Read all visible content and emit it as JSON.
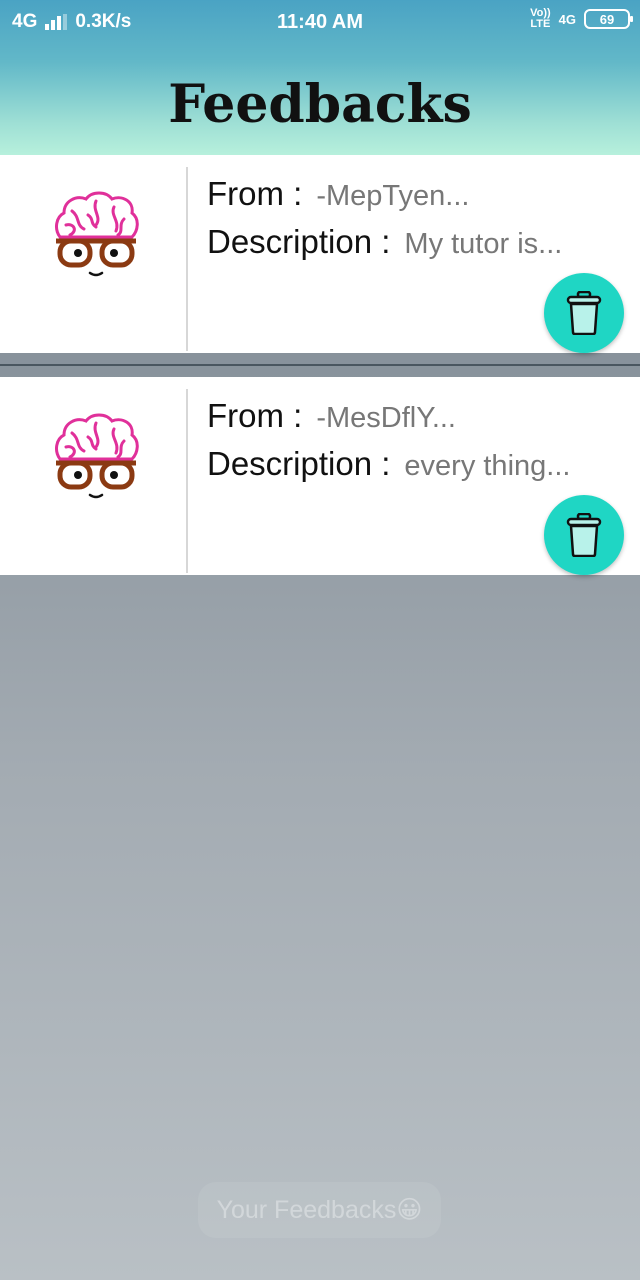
{
  "status_bar": {
    "network": "4G",
    "speed": "0.3K/s",
    "time": "11:40 AM",
    "volte_top": "Vo))",
    "volte_bottom": "LTE",
    "network_right": "4G",
    "battery": "69"
  },
  "header": {
    "title": "Feedbacks"
  },
  "feedbacks": [
    {
      "from_label": "From :",
      "from_value": "-MepTyen...",
      "desc_label": "Description :",
      "desc_value": "My tutor is..."
    },
    {
      "from_label": "From :",
      "from_value": "-MesDflY...",
      "desc_label": "Description :",
      "desc_value": "every thing..."
    }
  ],
  "toast": {
    "text": "Your Feedbacks😀"
  },
  "colors": {
    "accent": "#1fd6c4",
    "brain": "#e0309a",
    "glasses": "#8b3a12"
  },
  "icons": {
    "avatar": "brain-glasses-icon",
    "delete": "trash-icon",
    "signal": "signal-icon",
    "battery": "battery-icon"
  }
}
